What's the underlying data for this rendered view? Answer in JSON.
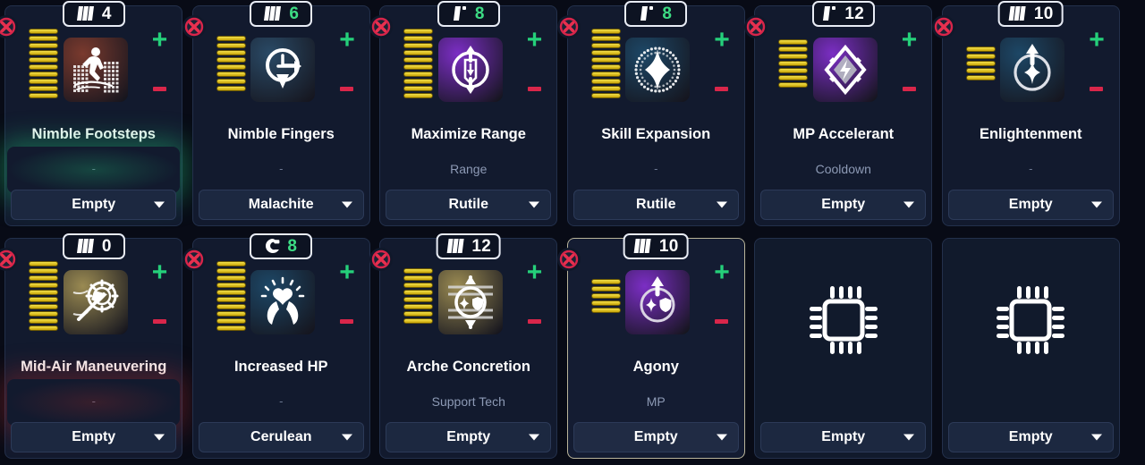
{
  "ui": {
    "background": "#080b16",
    "card_bg": "#121a2e",
    "accent_plus": "#25d07a",
    "accent_minus": "#d9264a",
    "pip_color": "#f3e04a",
    "badge_green": "#3ddc84",
    "selected_border": "#b9b49a"
  },
  "labels": {
    "dash": "-",
    "plus": "+",
    "empty": "Empty"
  },
  "cards": [
    {
      "name": "Nimble Footsteps",
      "subtitle": "-",
      "rank_icon": "rank-three-bars-icon",
      "rank_value": "4",
      "rank_value_color": "white",
      "pips": 10,
      "slot_value": "Empty",
      "icon": "runner-icon",
      "icon_bg": "#7a3a2e",
      "glow": "green",
      "selected": false,
      "empty_slot": false,
      "closable": true
    },
    {
      "name": "Nimble Fingers",
      "subtitle": "-",
      "rank_icon": "rank-three-bars-icon",
      "rank_value": "6",
      "rank_value_color": "green",
      "pips": 8,
      "slot_value": "Malachite",
      "icon": "clock-arrow-icon",
      "icon_bg": "#2a4a66",
      "glow": "none",
      "selected": false,
      "empty_slot": false,
      "closable": true
    },
    {
      "name": "Maximize Range",
      "subtitle": "Range",
      "rank_icon": "rank-one-bar-icon",
      "rank_value": "8",
      "rank_value_color": "green",
      "pips": 10,
      "slot_value": "Rutile",
      "icon": "range-arrows-icon",
      "icon_bg": "#7b2ec4",
      "glow": "none",
      "selected": false,
      "empty_slot": false,
      "closable": true
    },
    {
      "name": "Skill Expansion",
      "subtitle": "-",
      "rank_icon": "rank-one-bar-icon",
      "rank_value": "8",
      "rank_value_color": "green",
      "pips": 10,
      "slot_value": "Rutile",
      "icon": "sparkle-burst-icon",
      "icon_bg": "#1d4766",
      "glow": "none",
      "selected": false,
      "empty_slot": false,
      "closable": true
    },
    {
      "name": "MP Accelerant",
      "subtitle": "Cooldown",
      "rank_icon": "rank-one-bar-icon",
      "rank_value": "12",
      "rank_value_color": "white",
      "pips": 7,
      "slot_value": "Empty",
      "icon": "diamond-gem-icon",
      "icon_bg": "#7b2ec4",
      "glow": "none",
      "selected": false,
      "empty_slot": false,
      "closable": true
    },
    {
      "name": "Enlightenment",
      "subtitle": "-",
      "rank_icon": "rank-three-bars-icon",
      "rank_value": "10",
      "rank_value_color": "white",
      "pips": 5,
      "slot_value": "Empty",
      "icon": "star-circle-arrow-icon",
      "icon_bg": "#1d4766",
      "glow": "none",
      "selected": false,
      "empty_slot": false,
      "closable": true
    },
    {
      "name": "Mid-Air Maneuvering",
      "subtitle": "-",
      "rank_icon": "rank-three-bars-icon",
      "rank_value": "0",
      "rank_value_color": "white",
      "pips": 10,
      "slot_value": "Empty",
      "icon": "spear-swirl-icon",
      "icon_bg": "#9a8a52",
      "glow": "red",
      "selected": false,
      "empty_slot": false,
      "closable": true
    },
    {
      "name": "Increased HP",
      "subtitle": "-",
      "rank_icon": "rank-c-icon",
      "rank_value": "8",
      "rank_value_color": "green",
      "pips": 10,
      "slot_value": "Cerulean",
      "icon": "hands-heart-icon",
      "icon_bg": "#1d4766",
      "glow": "none",
      "selected": false,
      "empty_slot": false,
      "closable": true
    },
    {
      "name": "Arche Concretion",
      "subtitle": "Support Tech",
      "rank_icon": "rank-three-bars-icon",
      "rank_value": "12",
      "rank_value_color": "white",
      "pips": 8,
      "slot_value": "Empty",
      "icon": "shield-sparkle-cycle-icon",
      "icon_bg": "#9a8a52",
      "glow": "none",
      "selected": false,
      "empty_slot": false,
      "closable": true
    },
    {
      "name": "Agony",
      "subtitle": "MP",
      "rank_icon": "rank-three-bars-icon",
      "rank_value": "10",
      "rank_value_color": "white",
      "pips": 5,
      "slot_value": "Empty",
      "icon": "shield-sparkle-arrow-icon",
      "icon_bg": "#7b2ec4",
      "glow": "none",
      "selected": true,
      "empty_slot": false,
      "closable": true
    },
    {
      "name": "",
      "subtitle": "",
      "rank_icon": "",
      "rank_value": "",
      "rank_value_color": "white",
      "pips": 0,
      "slot_value": "Empty",
      "icon": "cpu-chip-icon",
      "icon_bg": "",
      "glow": "none",
      "selected": false,
      "empty_slot": true,
      "closable": false
    },
    {
      "name": "",
      "subtitle": "",
      "rank_icon": "",
      "rank_value": "",
      "rank_value_color": "white",
      "pips": 0,
      "slot_value": "Empty",
      "icon": "cpu-chip-icon",
      "icon_bg": "",
      "glow": "none",
      "selected": false,
      "empty_slot": true,
      "closable": false
    }
  ]
}
